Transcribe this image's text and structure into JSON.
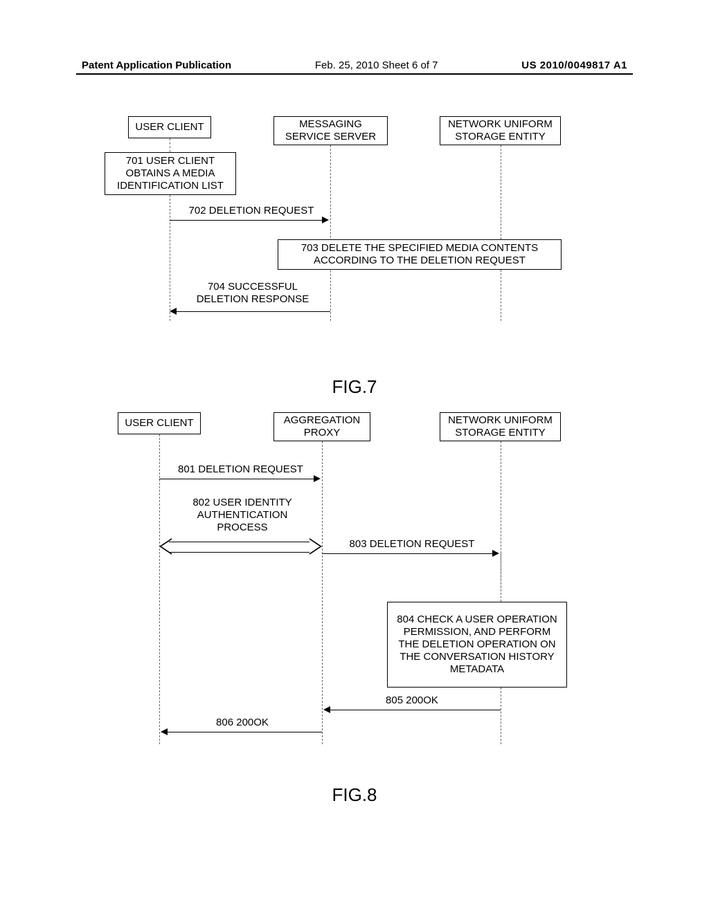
{
  "header": {
    "left": "Patent Application Publication",
    "center": "Feb. 25, 2010  Sheet 6 of 7",
    "right": "US 2010/0049817 A1"
  },
  "fig7": {
    "actors": {
      "user_client": "USER CLIENT",
      "service_server": "MESSAGING\nSERVICE SERVER",
      "storage_entity": "NETWORK UNIFORM\nSTORAGE ENTITY"
    },
    "steps": {
      "s701": "701 USER CLIENT\nOBTAINS A MEDIA\nIDENTIFICATION LIST",
      "s702": "702 DELETION REQUEST",
      "s703": "703 DELETE THE SPECIFIED MEDIA CONTENTS\nACCORDING TO THE DELETION REQUEST",
      "s704": "704 SUCCESSFUL\nDELETION RESPONSE"
    },
    "caption": "FIG.7"
  },
  "fig8": {
    "actors": {
      "user_client": "USER CLIENT",
      "aggregation_proxy": "AGGREGATION\nPROXY",
      "storage_entity": "NETWORK UNIFORM\nSTORAGE ENTITY"
    },
    "steps": {
      "s801": "801 DELETION REQUEST",
      "s802": "802 USER IDENTITY\nAUTHENTICATION\nPROCESS",
      "s803": "803 DELETION REQUEST",
      "s804": "804 CHECK A USER\nOPERATION PERMISSION, AND\nPERFORM THE DELETION\nOPERATION ON THE\nCONVERSATION HISTORY\nMETADATA",
      "s805": "805 200OK",
      "s806": "806 200OK"
    },
    "caption": "FIG.8"
  }
}
